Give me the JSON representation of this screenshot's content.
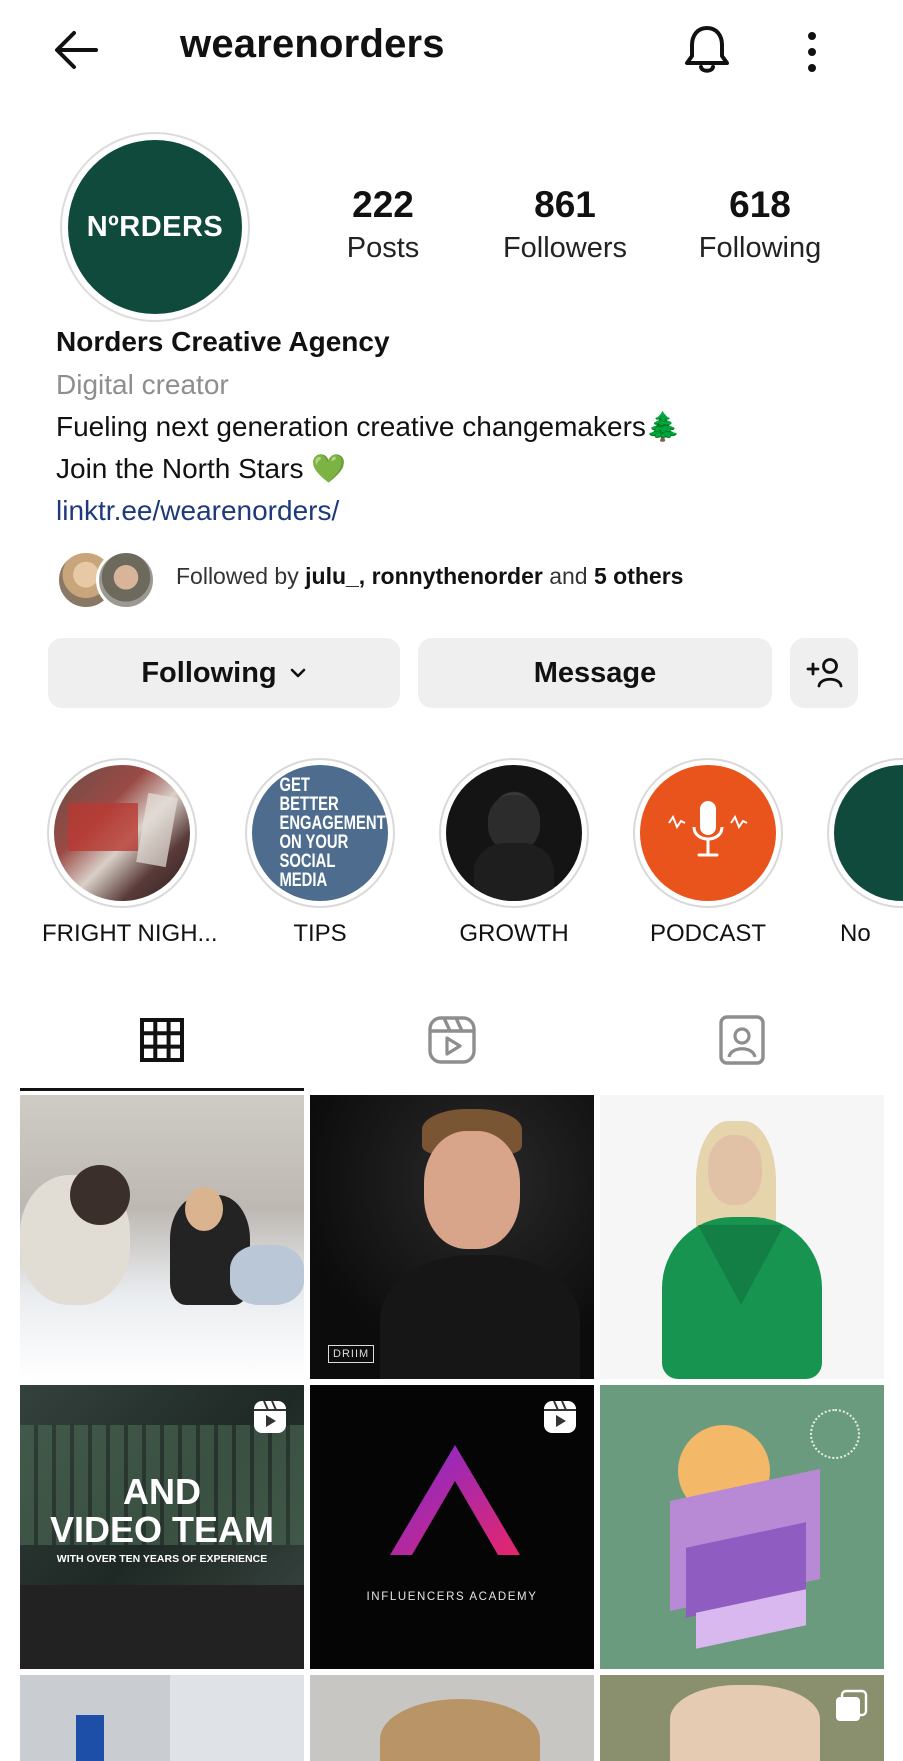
{
  "header": {
    "username": "wearenorders"
  },
  "profile": {
    "avatar_text": "NºRDERS",
    "stats": [
      {
        "value": "222",
        "label": "Posts"
      },
      {
        "value": "861",
        "label": "Followers"
      },
      {
        "value": "618",
        "label": "Following"
      }
    ],
    "name": "Norders Creative Agency",
    "category": "Digital creator",
    "bio_line1": "Fueling next generation creative changemakers🌲",
    "bio_line2": "Join the North Stars 💚",
    "link": "linktr.ee/wearenorders/",
    "followed_by": {
      "prefix": "Followed by",
      "names": "julu_, ronnythenorder",
      "mid": "and",
      "others": "5 others"
    }
  },
  "actions": {
    "following_label": "Following",
    "message_label": "Message"
  },
  "highlights": [
    {
      "label": "FRIGHT NIGH..."
    },
    {
      "label": "TIPS",
      "cover_text": "GET BETTER ENGAGEMENT ON YOUR SOCIAL MEDIA"
    },
    {
      "label": "GROWTH"
    },
    {
      "label": "PODCAST"
    },
    {
      "label": "No"
    }
  ],
  "grid": {
    "post2_tag": "DRIIM",
    "post4_text_top": "AND",
    "post4_text_mid": "VIDEO TEAM",
    "post4_text_sub": "WITH OVER TEN YEARS OF EXPERIENCE",
    "post5_text": "INFLUENCERS ACADEMY"
  },
  "colors": {
    "brand_green": "#0f4a3c",
    "podcast_orange": "#e9531c",
    "link_blue": "#1d3a7a"
  }
}
